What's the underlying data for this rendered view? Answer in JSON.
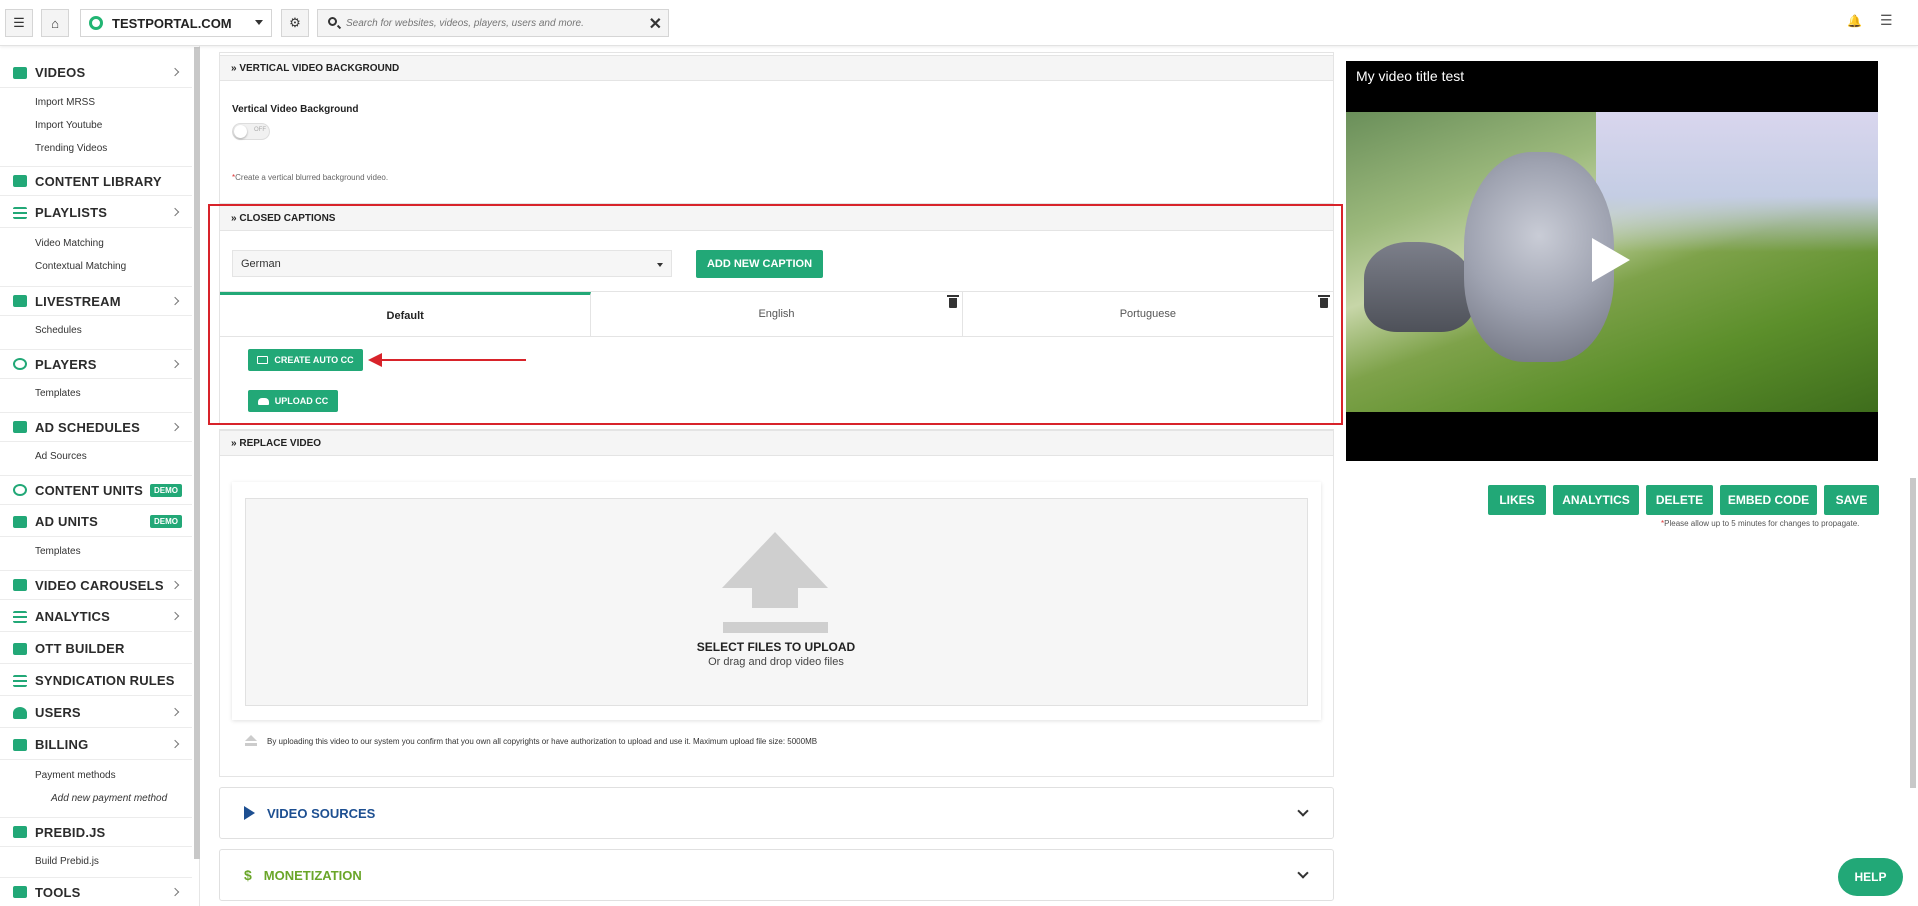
{
  "topbar": {
    "site_name": "TESTPORTAL.COM",
    "search_placeholder": "Search for websites, videos, players, users and more."
  },
  "sidebar": {
    "videos": "VIDEOS",
    "import_mrss": "Import MRSS",
    "import_youtube": "Import Youtube",
    "trending_videos": "Trending Videos",
    "content_library": "CONTENT LIBRARY",
    "playlists": "PLAYLISTS",
    "video_matching": "Video Matching",
    "contextual_matching": "Contextual Matching",
    "livestream": "LIVESTREAM",
    "schedules": "Schedules",
    "players": "PLAYERS",
    "players_templates": "Templates",
    "ad_schedules": "AD SCHEDULES",
    "ad_sources": "Ad Sources",
    "content_units": "CONTENT UNITS",
    "content_units_badge": "DEMO",
    "ad_units": "AD UNITS",
    "ad_units_badge": "DEMO",
    "ad_units_templates": "Templates",
    "video_carousels": "VIDEO CAROUSELS",
    "analytics": "ANALYTICS",
    "ott_builder": "OTT BUILDER",
    "syndication_rules": "SYNDICATION RULES",
    "users": "USERS",
    "billing": "BILLING",
    "payment_methods": "Payment methods",
    "add_payment_method": "Add new payment method",
    "prebid": "PREBID.JS",
    "build_prebid": "Build Prebid.js",
    "tools": "TOOLS"
  },
  "vertical_bg": {
    "section_title": "VERTICAL VIDEO BACKGROUND",
    "label": "Vertical Video Background",
    "toggle_text": "OFF",
    "hint": "Create a vertical blurred background video."
  },
  "captions": {
    "section_title": "CLOSED CAPTIONS",
    "language_selected": "German",
    "add_button": "ADD NEW CAPTION",
    "tabs": [
      "Default",
      "English",
      "Portuguese"
    ],
    "create_auto_cc": "CREATE AUTO CC",
    "upload_cc": "UPLOAD CC"
  },
  "replace_video": {
    "section_title": "REPLACE VIDEO",
    "drop_title": "SELECT FILES TO UPLOAD",
    "drop_subtitle": "Or drag and drop video files",
    "note": "By uploading this video to our system you confirm that you own all copyrights or have authorization to upload and use it. Maximum upload file size: 5000MB"
  },
  "accordions": {
    "video_sources": "VIDEO SOURCES",
    "monetization": "MONETIZATION"
  },
  "player": {
    "title": "My video title test"
  },
  "actions": {
    "likes": "LIKES",
    "analytics": "ANALYTICS",
    "delete": "DELETE",
    "embed_code": "EMBED CODE",
    "save": "SAVE",
    "propagate_note": "Please allow up to 5 minutes for changes to propagate."
  },
  "help": "HELP",
  "colors": {
    "accent": "#22a877",
    "highlight": "#d8232a",
    "video_sources": "#1d4f91",
    "monetization": "#6aa629"
  }
}
